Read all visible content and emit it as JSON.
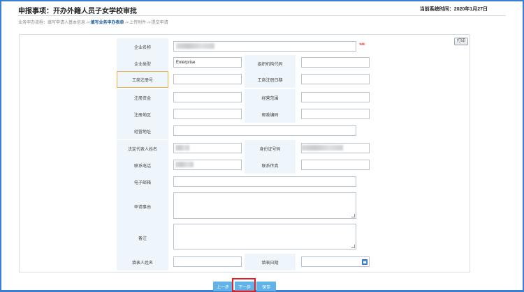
{
  "header": {
    "title": "申报事项：开办外籍人员子女学校审批",
    "system_time_label": "当前系统时间：2020年1月27日"
  },
  "steps": {
    "prefix": "业务申办流程：",
    "items": [
      "填写申请人基本信息",
      "填写业务申办表单",
      "上传附件",
      "提交申请"
    ],
    "separator": "->",
    "current_index": 1
  },
  "print_label": "打印",
  "form": {
    "company_name": {
      "label": "企业名称",
      "value": ""
    },
    "required_mark": "***",
    "company_type": {
      "label": "企业类型",
      "value": "Enterprise"
    },
    "org_code": {
      "label": "组织机构代码",
      "value": ""
    },
    "reg_no": {
      "label": "工商注册号",
      "value": ""
    },
    "reg_date": {
      "label": "工商注册日期",
      "value": ""
    },
    "reg_capital": {
      "label": "注册资金",
      "value": ""
    },
    "business_scope": {
      "label": "经营范围",
      "value": ""
    },
    "reg_area": {
      "label": "注册地区",
      "value": ""
    },
    "postal_code": {
      "label": "邮政编码",
      "value": ""
    },
    "business_address": {
      "label": "经营地址",
      "value": ""
    },
    "legal_rep": {
      "label": "法定代表人姓名",
      "value": ""
    },
    "id_number": {
      "label": "身份证号码",
      "value": ""
    },
    "phone": {
      "label": "联系电话",
      "value": ""
    },
    "fax": {
      "label": "联系传真",
      "value": ""
    },
    "email": {
      "label": "电子邮箱",
      "value": ""
    },
    "reason": {
      "label": "申请事由",
      "value": ""
    },
    "remark": {
      "label": "备注",
      "value": ""
    },
    "filler_name": {
      "label": "填表人姓名",
      "value": ""
    },
    "fill_date": {
      "label": "填表日期",
      "value": ""
    }
  },
  "buttons": {
    "prev": "上一步",
    "next": "下一步",
    "save": "保存"
  },
  "colors": {
    "frame": "#3b7fd0",
    "label_bg": "#eef6fc",
    "button_bg": "#5fb3e8",
    "highlight": "#e02020",
    "step_current": "#1c5ea8"
  }
}
